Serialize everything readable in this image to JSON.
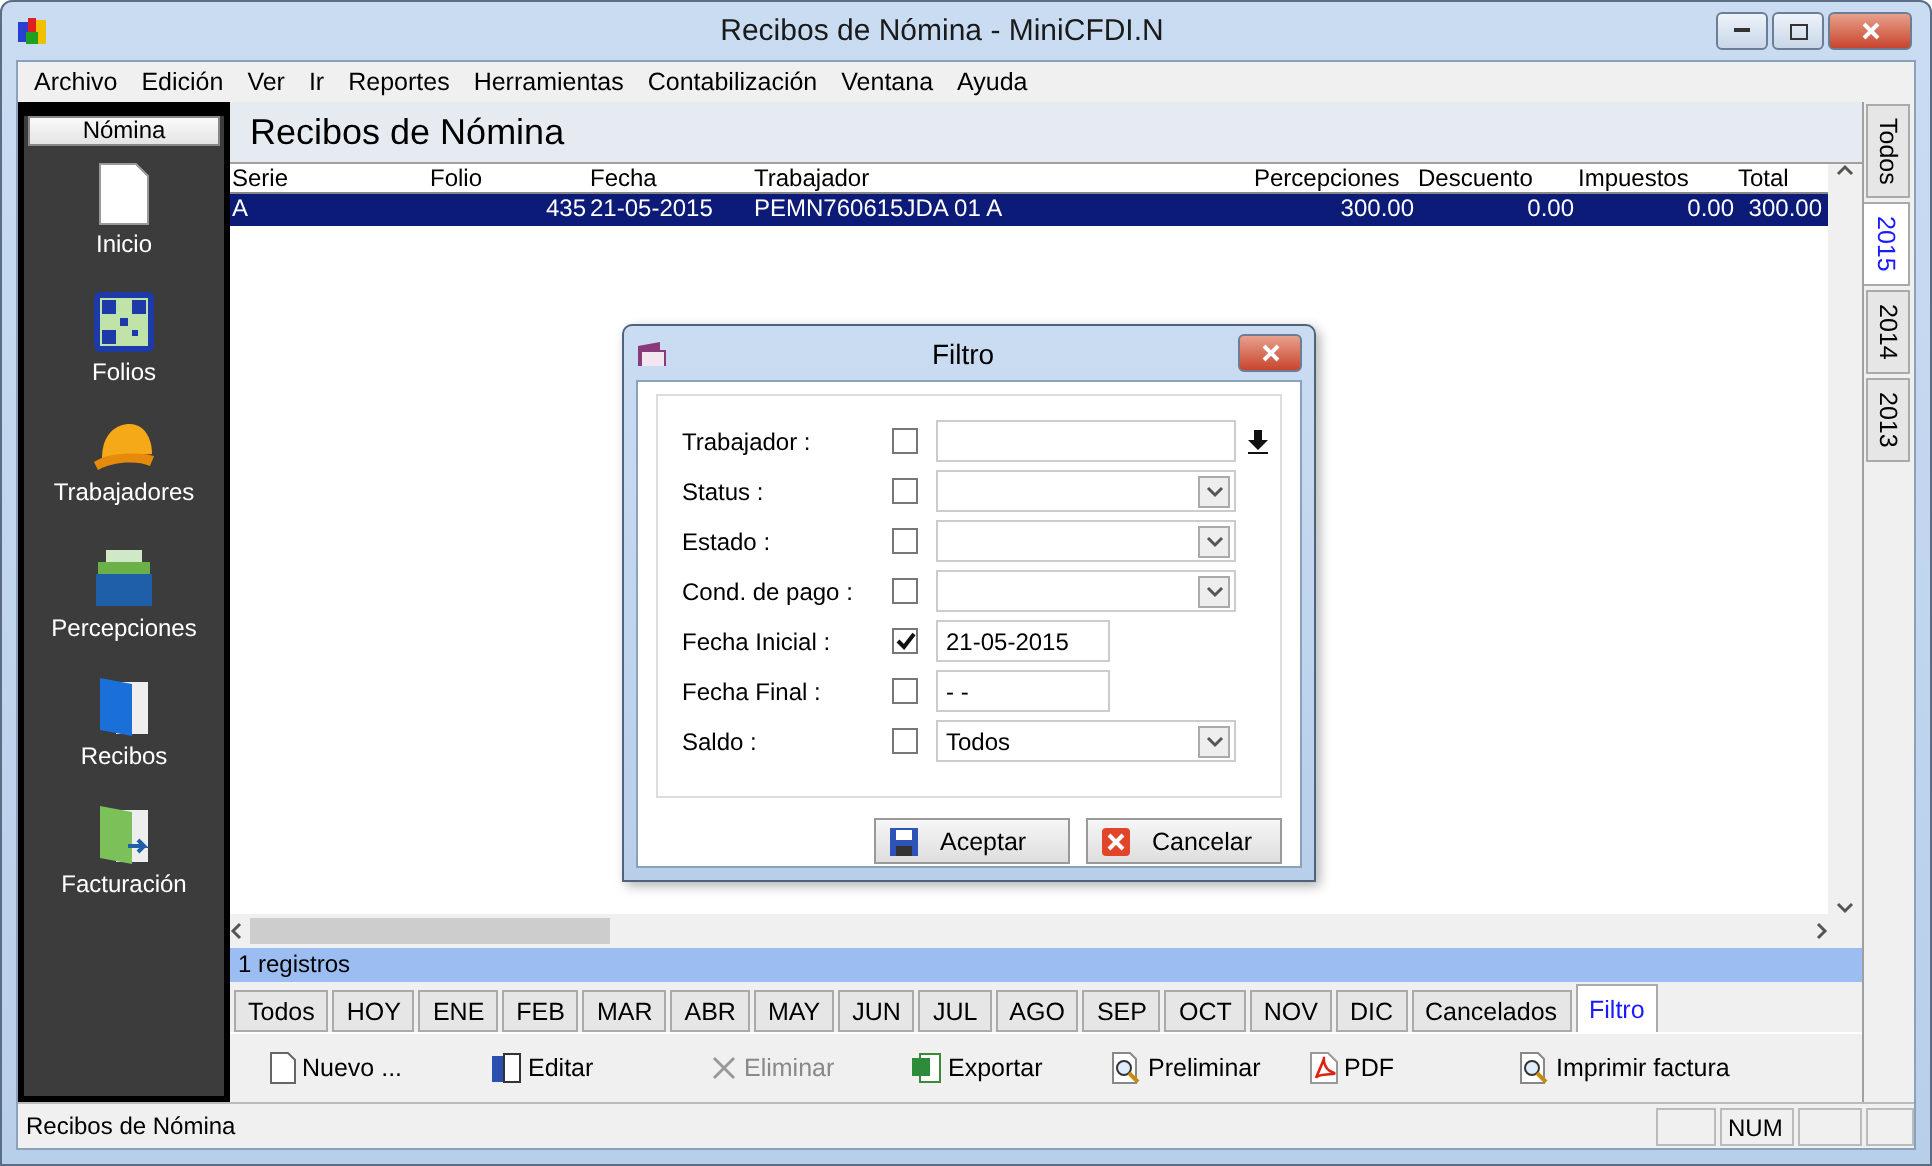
{
  "window": {
    "title": "Recibos de Nómina - MiniCFDI.N"
  },
  "menu": [
    "Archivo",
    "Edición",
    "Ver",
    "Ir",
    "Reportes",
    "Herramientas",
    "Contabilización",
    "Ventana",
    "Ayuda"
  ],
  "sidebar": {
    "header": "Nómina",
    "items": [
      {
        "label": "Inicio",
        "kind": "page"
      },
      {
        "label": "Folios",
        "kind": "qr"
      },
      {
        "label": "Trabajadores",
        "kind": "helmet"
      },
      {
        "label": "Percepciones",
        "kind": "folder"
      },
      {
        "label": "Recibos",
        "kind": "blue-book"
      },
      {
        "label": "Facturación",
        "kind": "green-book"
      }
    ]
  },
  "page_title": "Recibos de Nómina",
  "table": {
    "columns": [
      "Serie",
      "Folio",
      "Fecha",
      "Trabajador",
      "Percepciones",
      "Descuento",
      "Impuestos",
      "Total"
    ],
    "rows": [
      {
        "selected": true,
        "cells": [
          "A",
          "435",
          "21-05-2015",
          "PEMN760615JDA 01 A",
          "300.00",
          "0.00",
          "0.00",
          "300.00"
        ]
      }
    ]
  },
  "year_tabs": [
    {
      "label": "Todos",
      "selected": false
    },
    {
      "label": "2015",
      "selected": true
    },
    {
      "label": "2014",
      "selected": false
    },
    {
      "label": "2013",
      "selected": false
    }
  ],
  "record_count": "1 registros",
  "month_tabs": [
    {
      "label": "Todos",
      "selected": false
    },
    {
      "label": "HOY",
      "selected": false
    },
    {
      "label": "ENE",
      "selected": false
    },
    {
      "label": "FEB",
      "selected": false
    },
    {
      "label": "MAR",
      "selected": false
    },
    {
      "label": "ABR",
      "selected": false
    },
    {
      "label": "MAY",
      "selected": false
    },
    {
      "label": "JUN",
      "selected": false
    },
    {
      "label": "JUL",
      "selected": false
    },
    {
      "label": "AGO",
      "selected": false
    },
    {
      "label": "SEP",
      "selected": false
    },
    {
      "label": "OCT",
      "selected": false
    },
    {
      "label": "NOV",
      "selected": false
    },
    {
      "label": "DIC",
      "selected": false
    },
    {
      "label": "Cancelados",
      "selected": false
    },
    {
      "label": "Filtro",
      "selected": true
    }
  ],
  "toolbar": [
    {
      "label": "Nuevo ...",
      "kind": "new",
      "disabled": false
    },
    {
      "label": "Editar",
      "kind": "edit",
      "disabled": false
    },
    {
      "label": "Eliminar",
      "kind": "delete",
      "disabled": true
    },
    {
      "label": "Exportar",
      "kind": "excel",
      "disabled": false
    },
    {
      "label": "Preliminar",
      "kind": "preview",
      "disabled": false
    },
    {
      "label": "PDF",
      "kind": "pdf",
      "disabled": false
    },
    {
      "label": "Imprimir factura",
      "kind": "preview",
      "disabled": false
    }
  ],
  "status_bar": {
    "text": "Recibos de Nómina",
    "num": "NUM"
  },
  "dialog": {
    "title": "Filtro",
    "fields": [
      {
        "label": "Trabajador :",
        "checked": false,
        "kind": "lookup"
      },
      {
        "label": "Status :",
        "checked": false,
        "kind": "select"
      },
      {
        "label": "Estado :",
        "checked": false,
        "kind": "select"
      },
      {
        "label": "Cond. de pago :",
        "checked": false,
        "kind": "select"
      },
      {
        "label": "Fecha Inicial :",
        "checked": true,
        "kind": "date",
        "value": "21-05-2015"
      },
      {
        "label": "Fecha Final :",
        "checked": false,
        "kind": "date",
        "value": "- -"
      },
      {
        "label": "Saldo :",
        "checked": false,
        "kind": "select",
        "value": "Todos"
      }
    ],
    "buttons": [
      {
        "label": "Aceptar",
        "kind": "save"
      },
      {
        "label": "Cancelar",
        "kind": "cancel"
      }
    ]
  }
}
